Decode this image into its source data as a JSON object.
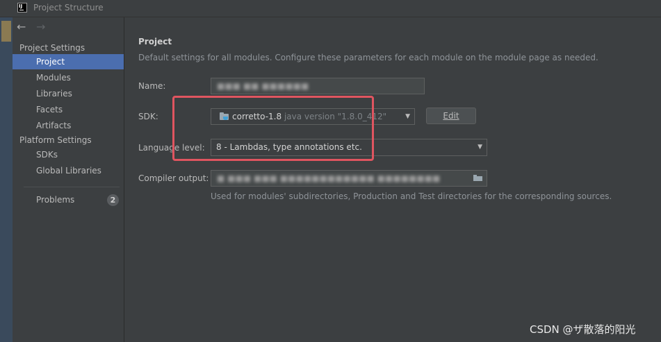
{
  "window": {
    "title": "Project Structure",
    "app_icon_text": "IJ"
  },
  "sidebar": {
    "project_settings_label": "Project Settings",
    "project_settings_items": [
      {
        "label": "Project",
        "selected": true
      },
      {
        "label": "Modules"
      },
      {
        "label": "Libraries"
      },
      {
        "label": "Facets"
      },
      {
        "label": "Artifacts"
      }
    ],
    "platform_settings_label": "Platform Settings",
    "platform_settings_items": [
      {
        "label": "SDKs"
      },
      {
        "label": "Global Libraries"
      }
    ],
    "problems": {
      "label": "Problems",
      "count": "2"
    }
  },
  "main": {
    "title": "Project",
    "description": "Default settings for all modules. Configure these parameters for each module on the module page as needed.",
    "name": {
      "label": "Name:",
      "value": "■■■ ■■ ■■■■■■"
    },
    "sdk": {
      "label": "SDK:",
      "name": "corretto-1.8",
      "version": "java version \"1.8.0_412\"",
      "edit_label": "Edit",
      "icon": "jdk-folder-icon"
    },
    "language_level": {
      "label": "Language level:",
      "value": "8 - Lambdas, type annotations etc."
    },
    "compiler_output": {
      "label": "Compiler output:",
      "value": "■ ■■■ ■■■ ■■■■■■■■■■■■ ■■■■■■■■",
      "hint": "Used for modules' subdirectories, Production and Test directories for the corresponding sources.",
      "icon": "open-folder-icon"
    }
  },
  "colors": {
    "selection": "#4b6eaf",
    "highlight_box": "#e05560",
    "background": "#3c3f41"
  },
  "watermark": "CSDN @ザ散落的阳光"
}
